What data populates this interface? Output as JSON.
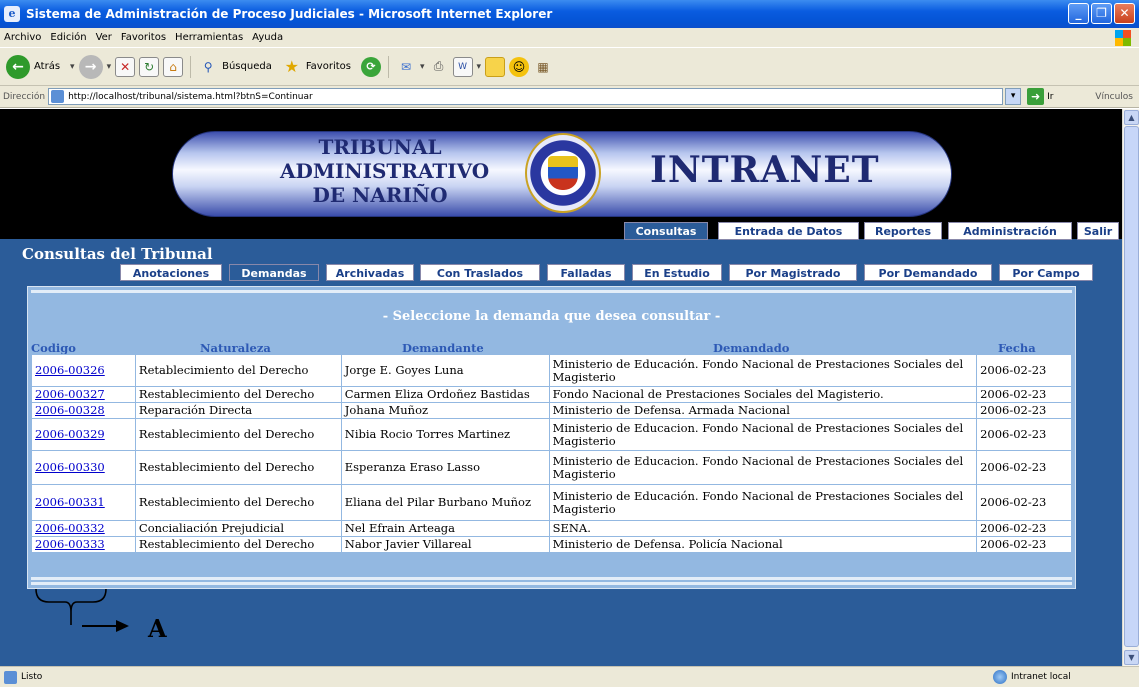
{
  "window": {
    "title": "Sistema de Administración de Proceso Judiciales - Microsoft Internet Explorer",
    "min_glyph": "_",
    "max_glyph": "❐",
    "close_glyph": "✕"
  },
  "menu": [
    "Archivo",
    "Edición",
    "Ver",
    "Favoritos",
    "Herramientas",
    "Ayuda"
  ],
  "toolbar": {
    "back_label": "Atrás",
    "search_label": "Búsqueda",
    "favorites_label": "Favoritos"
  },
  "address": {
    "label": "Dirección",
    "url": "http://localhost/tribunal/sistema.html?btnS=Continuar",
    "go_label": "Ir",
    "links_label": "Vínculos"
  },
  "banner": {
    "title_line1": "TRIBUNAL",
    "title_line2": "ADMINISTRATIVO",
    "title_line3": "DE NARIÑO",
    "brand": "INTRANET"
  },
  "top_nav": [
    "Consultas",
    "Entrada de Datos",
    "Reportes",
    "Administración",
    "Salir"
  ],
  "section_title": "Consultas del Tribunal",
  "sub_nav": [
    "Anotaciones",
    "Demandas",
    "Archivadas",
    "Con Traslados",
    "Falladas",
    "En Estudio",
    "Por Magistrado",
    "Por Demandado",
    "Por Campo"
  ],
  "panel_heading": "- Seleccione la demanda que desea consultar -",
  "columns": [
    "Codigo",
    "Naturaleza",
    "Demandante",
    "Demandado",
    "Fecha"
  ],
  "rows": [
    {
      "codigo": "2006-00326",
      "naturaleza": "Retablecimiento del Derecho",
      "demandante": "Jorge E. Goyes Luna",
      "demandado": "Ministerio de Educación. Fondo Nacional de Prestaciones Sociales del Magisterio",
      "fecha": "2006-02-23"
    },
    {
      "codigo": "2006-00327",
      "naturaleza": "Restablecimiento del Derecho",
      "demandante": "Carmen Eliza Ordoñez Bastidas",
      "demandado": "Fondo Nacional de Prestaciones Sociales del Magisterio.",
      "fecha": "2006-02-23"
    },
    {
      "codigo": "2006-00328",
      "naturaleza": "Reparación Directa",
      "demandante": "Johana Muñoz",
      "demandado": "Ministerio de Defensa. Armada Nacional",
      "fecha": "2006-02-23"
    },
    {
      "codigo": "2006-00329",
      "naturaleza": "Restablecimiento del Derecho",
      "demandante": "Nibia Rocio Torres Martinez",
      "demandado": "Ministerio de Educacion. Fondo Nacional de Prestaciones Sociales del Magisterio",
      "fecha": "2006-02-23"
    },
    {
      "codigo": "2006-00330",
      "naturaleza": "Restablecimiento del Derecho",
      "demandante": "Esperanza Eraso Lasso",
      "demandado": "Ministerio de Educacion. Fondo Nacional de Prestaciones Sociales del Magisterio",
      "fecha": "2006-02-23"
    },
    {
      "codigo": "2006-00331",
      "naturaleza": "Restablecimiento del Derecho",
      "demandante": "Eliana del Pilar Burbano Muñoz",
      "demandado": "Ministerio de Educación. Fondo Nacional de Prestaciones Sociales del Magisterio",
      "fecha": "2006-02-23"
    },
    {
      "codigo": "2006-00332",
      "naturaleza": "Concialiación Prejudicial",
      "demandante": "Nel Efrain Arteaga",
      "demandado": "SENA.",
      "fecha": "2006-02-23"
    },
    {
      "codigo": "2006-00333",
      "naturaleza": "Restablecimiento del Derecho",
      "demandante": "Nabor Javier Villareal",
      "demandado": "Ministerio de Defensa. Policía Nacional",
      "fecha": "2006-02-23"
    }
  ],
  "annotation_letter": "A",
  "status": {
    "left": "Listo",
    "zone": "Intranet local"
  }
}
